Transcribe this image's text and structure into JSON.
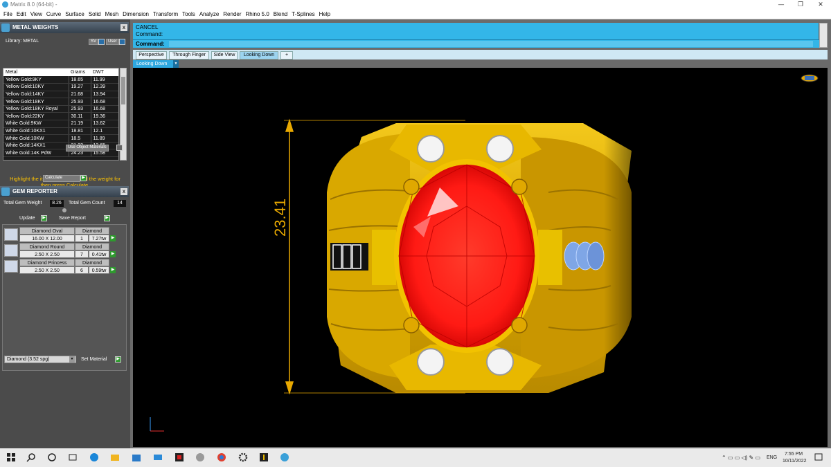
{
  "window": {
    "title": "Matrix 8.0 (64-bit) -",
    "minimize": "—",
    "maximize": "❐",
    "close": "✕"
  },
  "menu": [
    "File",
    "Edit",
    "View",
    "Curve",
    "Surface",
    "Solid",
    "Mesh",
    "Dimension",
    "Transform",
    "Tools",
    "Analyze",
    "Render",
    "Rhino 5.0",
    "Blend",
    "T-Splines",
    "Help"
  ],
  "metal_weights": {
    "title": "METAL WEIGHTS",
    "close": "x",
    "library_label": "Library: METAL",
    "sv_label": "SV",
    "user_label": "User",
    "columns": [
      "Metal",
      "Grams",
      "DWT"
    ],
    "rows": [
      [
        "Yellow Gold:9KY",
        "18.65",
        "11.99"
      ],
      [
        "Yellow Gold:10KY",
        "19.27",
        "12.39"
      ],
      [
        "Yellow Gold:14KY",
        "21.68",
        "13.94"
      ],
      [
        "Yellow Gold:18KY",
        "25.93",
        "16.68"
      ],
      [
        "Yellow Gold:18KY Royal",
        "25.93",
        "16.68"
      ],
      [
        "Yellow Gold:22KY",
        "30.11",
        "19.36"
      ],
      [
        "White Gold:9KW",
        "21.19",
        "13.62"
      ],
      [
        "White Gold:10KX1",
        "18.81",
        "12.1"
      ],
      [
        "White Gold:10KW",
        "18.5",
        "11.89"
      ],
      [
        "White Gold:14KX1",
        "21.22",
        "13.65"
      ],
      [
        "White Gold:14K PdW",
        "24.23",
        "15.58"
      ]
    ],
    "use_object_materials": "Use Object Materials",
    "hint": "Highlight the item you want to find the weight for then press Calculate.",
    "calculate": "Calculate"
  },
  "gem_reporter": {
    "title": "GEM REPORTER",
    "close": "x",
    "total_weight_label": "Total Gem Weight",
    "total_weight": "8.26",
    "total_count_label": "Total Gem Count",
    "total_count": "14",
    "update": "Update",
    "save_report": "Save Report",
    "gems": [
      {
        "name": "Diamond Oval",
        "size": "16.00 X 12.00",
        "type": "Diamond",
        "qty": "1",
        "weight": "7.27tw"
      },
      {
        "name": "Diamond Round",
        "size": "2.50 X 2.50",
        "type": "Diamond",
        "qty": "7",
        "weight": "0.41tw"
      },
      {
        "name": "Diamond Princess",
        "size": "2.50 X 2.50",
        "type": "Diamond",
        "qty": "6",
        "weight": "0.59tw"
      }
    ],
    "material_select": "Diamond    (3.52 spg)",
    "set_material": "Set Material"
  },
  "command": {
    "line1": "CANCEL",
    "line2": "Command:",
    "prompt": "Command:"
  },
  "viewport_tabs": [
    "Perspective",
    "Through Finger",
    "Side View",
    "Looking Down"
  ],
  "active_tab": "Looking Down",
  "add_tab": "+",
  "viewport_label": "Looking Down",
  "dimension": "23.41",
  "colors": {
    "accent": "#33b6e8",
    "gold": "#e8b800",
    "ruby": "#ff2020",
    "dimension": "#e8a800"
  },
  "taskbar": {
    "time": "7:55 PM",
    "date": "10/11/2022",
    "lang": "ENG"
  }
}
